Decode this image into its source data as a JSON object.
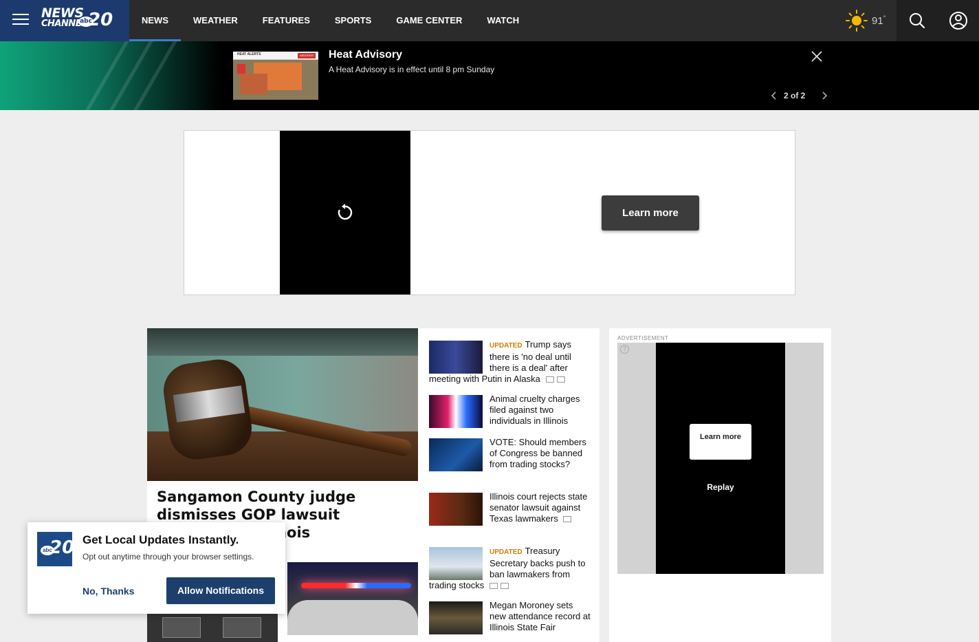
{
  "brand": {
    "logo_line1": "NEWS",
    "logo_line2": "CHANNEL",
    "logo_abc": "abc",
    "logo_number": "20"
  },
  "nav": {
    "items": [
      {
        "label": "NEWS",
        "active": true
      },
      {
        "label": "WEATHER"
      },
      {
        "label": "FEATURES"
      },
      {
        "label": "SPORTS"
      },
      {
        "label": "GAME CENTER"
      },
      {
        "label": "WATCH"
      }
    ]
  },
  "weather": {
    "icon": "sun-icon",
    "temp": "91",
    "unit": "°",
    "sun_color": "#f5b800"
  },
  "alert": {
    "title": "Heat Advisory",
    "subtitle": "A Heat Advisory is in effect until 8 pm Sunday",
    "pager": "2 of 2",
    "thumb_header": "HEAT ALERTS",
    "thumb_brand": "WEATHER"
  },
  "top_ad": {
    "learn_more": "Learn more"
  },
  "hero": {
    "title": "Sangamon County judge dismisses GOP lawsuit challenging Illinois"
  },
  "stories": [
    {
      "tag": "UPDATED",
      "title": "Trump says there is 'no deal until there is a deal' after meeting with Putin in Alaska",
      "icons": [
        "video-icon",
        "gallery-icon"
      ]
    },
    {
      "tag": "",
      "title": "Animal cruelty charges filed against two individuals in Illinois",
      "icons": []
    },
    {
      "tag": "",
      "title": "VOTE: Should members of Congress be banned from trading stocks?",
      "icons": []
    },
    {
      "tag": "",
      "title": "Illinois court rejects state senator lawsuit against Texas lawmakers",
      "icons": [
        "video-icon"
      ]
    },
    {
      "tag": "UPDATED",
      "title": "Treasury Secretary backs push to ban lawmakers from trading stocks",
      "icons": [
        "video-icon",
        "gallery-icon"
      ]
    },
    {
      "tag": "",
      "title": "Megan Moroney sets new attendance record at Illinois State Fair",
      "icons": []
    }
  ],
  "side_ad": {
    "label": "ADVERTISEMENT",
    "learn_more": "Learn more",
    "replay": "Replay",
    "help": "?"
  },
  "notification": {
    "title": "Get Local Updates Instantly.",
    "subtitle": "Opt out anytime through your browser settings.",
    "decline": "No, Thanks",
    "accept": "Allow Notifications"
  },
  "colors": {
    "brand_blue": "#1c3a6e",
    "accent_orange": "#d77a00",
    "alert_green": "#0fa37a"
  }
}
